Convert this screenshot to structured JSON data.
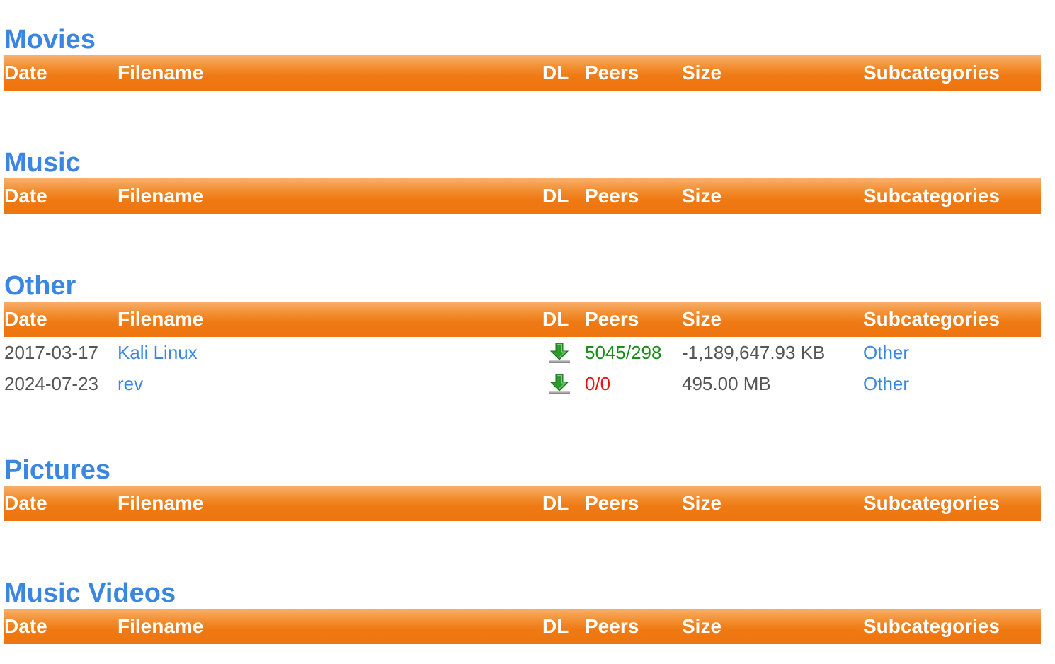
{
  "columns": {
    "date": "Date",
    "filename": "Filename",
    "dl": "DL",
    "peers": "Peers",
    "size": "Size",
    "subcategories": "Subcategories"
  },
  "colors": {
    "title": "#3a86e0",
    "header_bar": "#ee7510",
    "peers_good": "#1a8c1a",
    "peers_bad": "#ee1111"
  },
  "sections": [
    {
      "title": "Movies",
      "rows": []
    },
    {
      "title": "Music",
      "rows": []
    },
    {
      "title": "Other",
      "rows": [
        {
          "date": "2017-03-17",
          "filename": "Kali Linux",
          "dl_icon": "download-arrow-icon",
          "peers": "5045/298",
          "peers_status": "good",
          "size": "-1,189,647.93 KB",
          "subcategory": "Other"
        },
        {
          "date": "2024-07-23",
          "filename": "rev",
          "dl_icon": "download-arrow-icon",
          "peers": "0/0",
          "peers_status": "bad",
          "size": "495.00 MB",
          "subcategory": "Other"
        }
      ]
    },
    {
      "title": "Pictures",
      "rows": []
    },
    {
      "title": "Music Videos",
      "rows": []
    }
  ]
}
